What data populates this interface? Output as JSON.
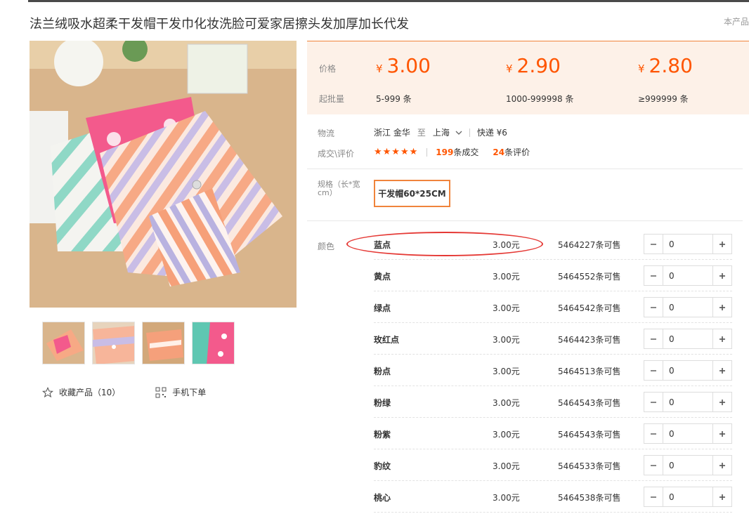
{
  "product": {
    "title": "法兰绒吸水超柔干发帽干发巾化妆洗脸可爱家居擦头发加厚加长代发",
    "corner_note": "本产品"
  },
  "gallery": {
    "thumbnail_count": 4
  },
  "actions": {
    "favorite_label": "收藏产品（10）",
    "mobile_order_label": "手机下单"
  },
  "price": {
    "price_label": "价格",
    "moq_label": "起批量",
    "currency": "¥",
    "tiers": [
      {
        "price": "3.00",
        "range": "5-999 条"
      },
      {
        "price": "2.90",
        "range": "1000-999998 条"
      },
      {
        "price": "2.80",
        "range": "≥999999 条"
      }
    ]
  },
  "logistics": {
    "label": "物流",
    "from": "浙江 金华",
    "to_word": "至",
    "to": "上海",
    "shipping": "快递 ¥6"
  },
  "reviews": {
    "label": "成交\\评价",
    "stars": "★★★★★",
    "deals_count": "199",
    "deals_suffix": "条成交",
    "reviews_count": "24",
    "reviews_suffix": "条评价"
  },
  "spec": {
    "label": "规格（长*宽cm）",
    "selected": "干发帽60*25CM"
  },
  "colors": {
    "label": "颜色",
    "items": [
      {
        "name": "蓝点",
        "price": "3.00元",
        "stock": "5464227条可售",
        "qty": "0"
      },
      {
        "name": "黄点",
        "price": "3.00元",
        "stock": "5464552条可售",
        "qty": "0"
      },
      {
        "name": "绿点",
        "price": "3.00元",
        "stock": "5464542条可售",
        "qty": "0"
      },
      {
        "name": "玫红点",
        "price": "3.00元",
        "stock": "5464423条可售",
        "qty": "0"
      },
      {
        "name": "粉点",
        "price": "3.00元",
        "stock": "5464513条可售",
        "qty": "0"
      },
      {
        "name": "粉绿",
        "price": "3.00元",
        "stock": "5464543条可售",
        "qty": "0"
      },
      {
        "name": "粉紫",
        "price": "3.00元",
        "stock": "5464543条可售",
        "qty": "0"
      },
      {
        "name": "豹纹",
        "price": "3.00元",
        "stock": "5464533条可售",
        "qty": "0"
      },
      {
        "name": "桃心",
        "price": "3.00元",
        "stock": "5464538条可售",
        "qty": "0"
      }
    ]
  },
  "theme": {
    "accent": "#ff5500",
    "price_bg": "#fdf1e8",
    "highlight_color": "#e53935"
  }
}
